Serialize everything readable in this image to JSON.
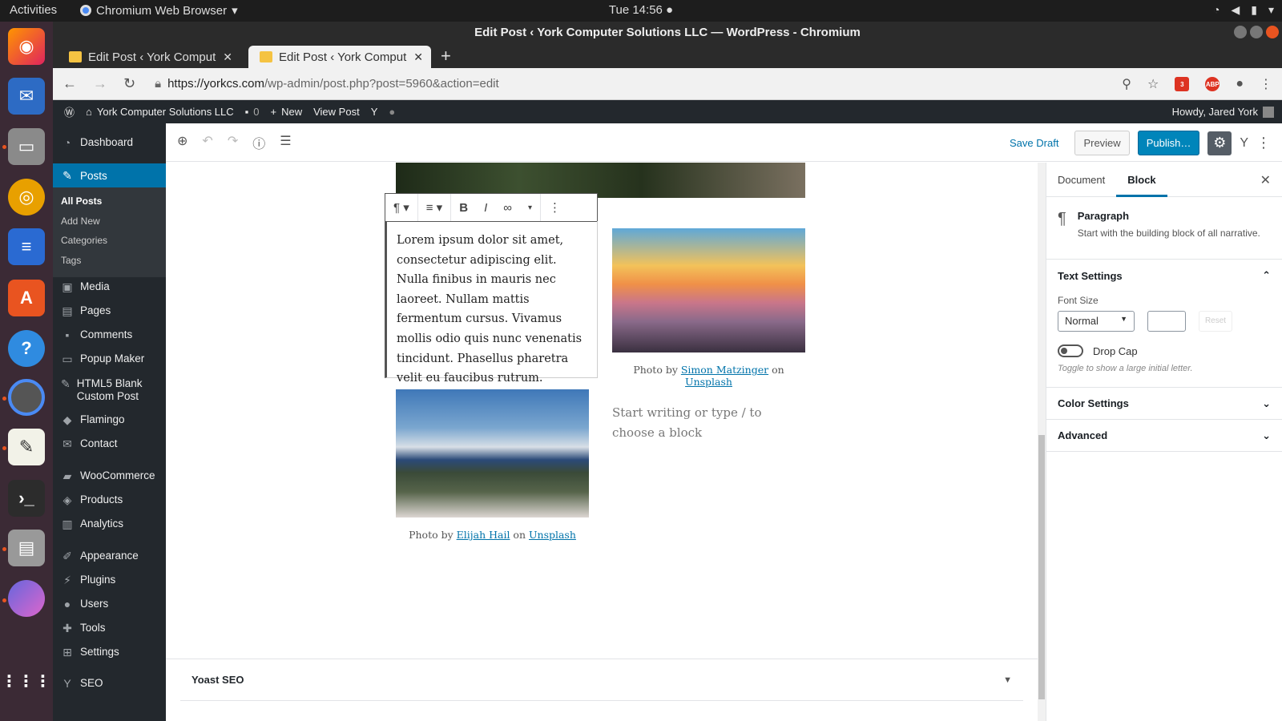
{
  "system_bar": {
    "activities": "Activities",
    "app": "Chromium Web Browser",
    "clock": "Tue 14:56"
  },
  "window": {
    "title": "Edit Post ‹ York Computer Solutions LLC — WordPress - Chromium"
  },
  "tabs": [
    {
      "label": "Edit Post ‹ York Computer"
    },
    {
      "label": "Edit Post ‹ York Computer"
    }
  ],
  "address": {
    "url_host": "https://yorkcs.com",
    "url_path": "/wp-admin/post.php?post=5960&action=edit",
    "ext_badge": "3",
    "abp": "ABP"
  },
  "adminbar": {
    "site": "York Computer Solutions LLC",
    "comments": "0",
    "new": "New",
    "view": "View Post",
    "howdy": "Howdy, Jared York"
  },
  "sidebar": {
    "items": [
      {
        "label": "Dashboard",
        "icon": "dashboard-icon"
      },
      {
        "label": "Posts",
        "icon": "pin-icon"
      },
      {
        "label": "Media",
        "icon": "media-icon"
      },
      {
        "label": "Pages",
        "icon": "pages-icon"
      },
      {
        "label": "Comments",
        "icon": "comments-icon"
      },
      {
        "label": "Popup Maker",
        "icon": "popup-icon"
      },
      {
        "label": "HTML5 Blank Custom Post",
        "icon": "pin-icon"
      },
      {
        "label": "Flamingo",
        "icon": "flamingo-icon"
      },
      {
        "label": "Contact",
        "icon": "mail-icon"
      },
      {
        "label": "WooCommerce",
        "icon": "woo-icon"
      },
      {
        "label": "Products",
        "icon": "products-icon"
      },
      {
        "label": "Analytics",
        "icon": "analytics-icon"
      },
      {
        "label": "Appearance",
        "icon": "brush-icon"
      },
      {
        "label": "Plugins",
        "icon": "plugin-icon"
      },
      {
        "label": "Users",
        "icon": "users-icon"
      },
      {
        "label": "Tools",
        "icon": "wrench-icon"
      },
      {
        "label": "Settings",
        "icon": "settings-icon"
      },
      {
        "label": "SEO",
        "icon": "yoast-icon"
      }
    ],
    "sub": [
      "All Posts",
      "Add New",
      "Categories",
      "Tags"
    ]
  },
  "editor_top": {
    "save_draft": "Save Draft",
    "preview": "Preview",
    "publish": "Publish…"
  },
  "content": {
    "paragraph": "Lorem ipsum dolor sit amet, consectetur adipiscing elit. Nulla finibus in mauris nec laoreet. Nullam mattis fermentum cursus. Vivamus mollis odio quis nunc venenatis tincidunt. Phasellus pharetra velit eu faucibus rutrum.",
    "cap1": {
      "pre": "Photo by ",
      "author": "Simon Matzinger",
      "mid": " on ",
      "site": "Unsplash"
    },
    "cap2": {
      "pre": "Photo by ",
      "author": "Elijah Hail",
      "mid": " on ",
      "site": "Unsplash"
    },
    "placeholder": "Start writing or type / to choose a block",
    "yoast": "Yoast SEO"
  },
  "settings": {
    "tab_document": "Document",
    "tab_block": "Block",
    "block_name": "Paragraph",
    "block_desc": "Start with the building block of all narrative.",
    "text_settings": "Text Settings",
    "font_size_label": "Font Size",
    "font_size_value": "Normal",
    "reset": "Reset",
    "drop_cap": "Drop Cap",
    "drop_cap_help": "Toggle to show a large initial letter.",
    "color_settings": "Color Settings",
    "advanced": "Advanced"
  }
}
